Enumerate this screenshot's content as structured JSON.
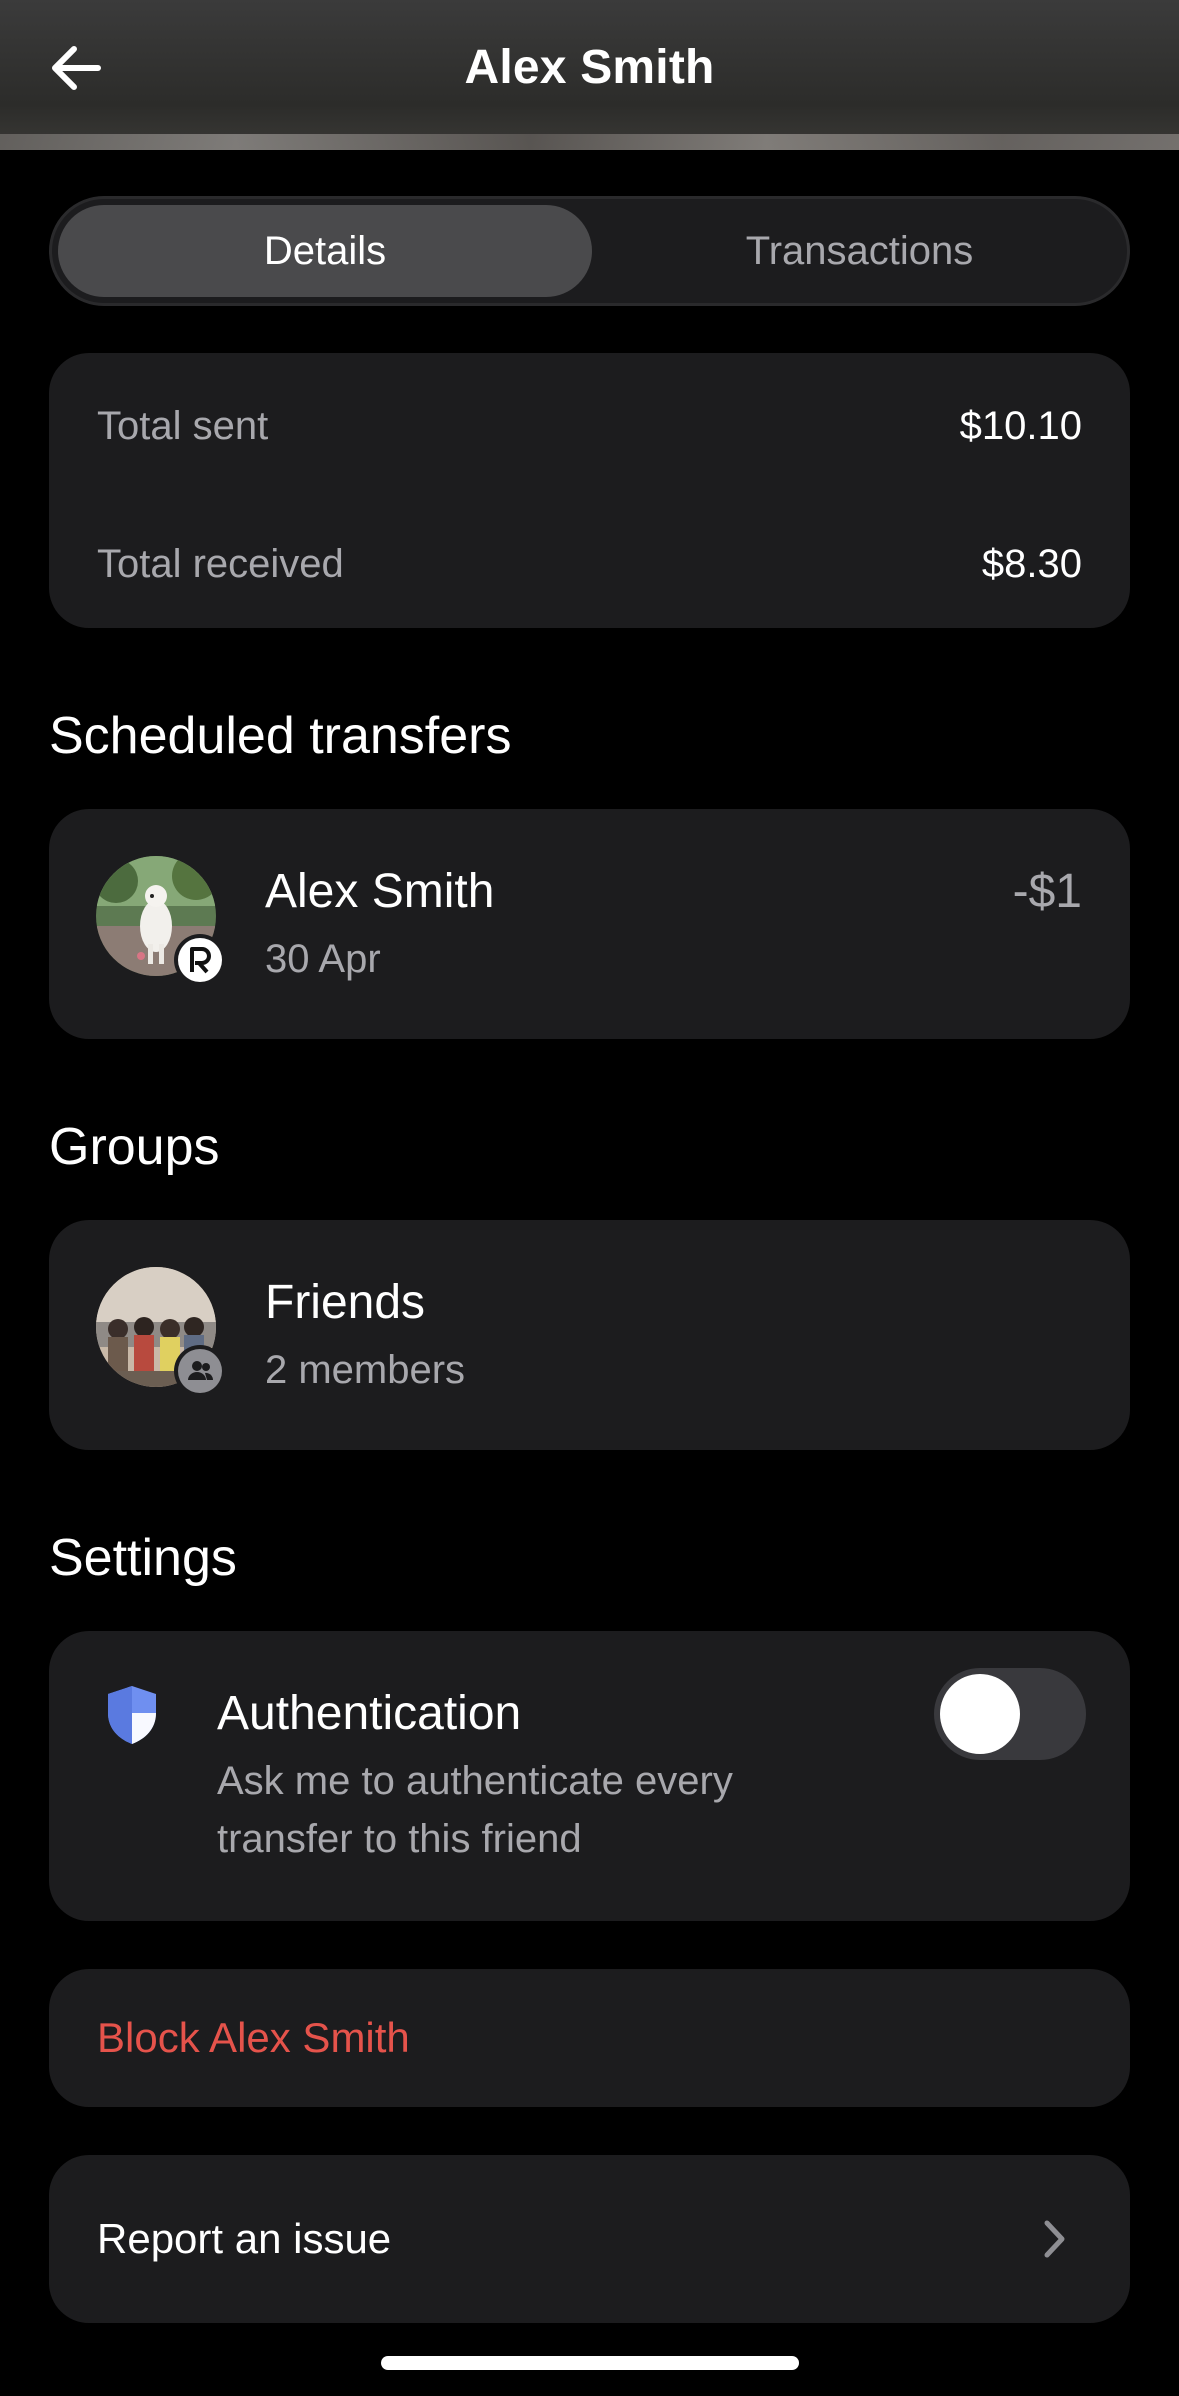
{
  "header": {
    "title": "Alex Smith",
    "back_icon": "arrow-left-icon"
  },
  "tabs": [
    {
      "label": "Details",
      "active": true
    },
    {
      "label": "Transactions",
      "active": false
    }
  ],
  "totals": {
    "sent_label": "Total sent",
    "sent_value": "$10.10",
    "received_label": "Total received",
    "received_value": "$8.30"
  },
  "scheduled": {
    "title": "Scheduled transfers",
    "items": [
      {
        "name": "Alex Smith",
        "date": "30 Apr",
        "amount": "-$1",
        "badge_icon": "revolut-r-icon"
      }
    ]
  },
  "groups": {
    "title": "Groups",
    "items": [
      {
        "name": "Friends",
        "members": "2 members",
        "badge_icon": "group-icon"
      }
    ]
  },
  "settings": {
    "title": "Settings",
    "auth": {
      "title": "Authentication",
      "desc_line1": "Ask me to authenticate every",
      "desc_line2": "transfer to this friend",
      "enabled": false,
      "icon": "shield-icon"
    }
  },
  "actions": {
    "block_label": "Block Alex Smith",
    "report_label": "Report an issue"
  },
  "colors": {
    "background": "#000000",
    "card": "#1c1c1e",
    "muted_text": "#a8a8ad",
    "danger": "#e5534b",
    "shield_blue": "#6f8ff0"
  }
}
